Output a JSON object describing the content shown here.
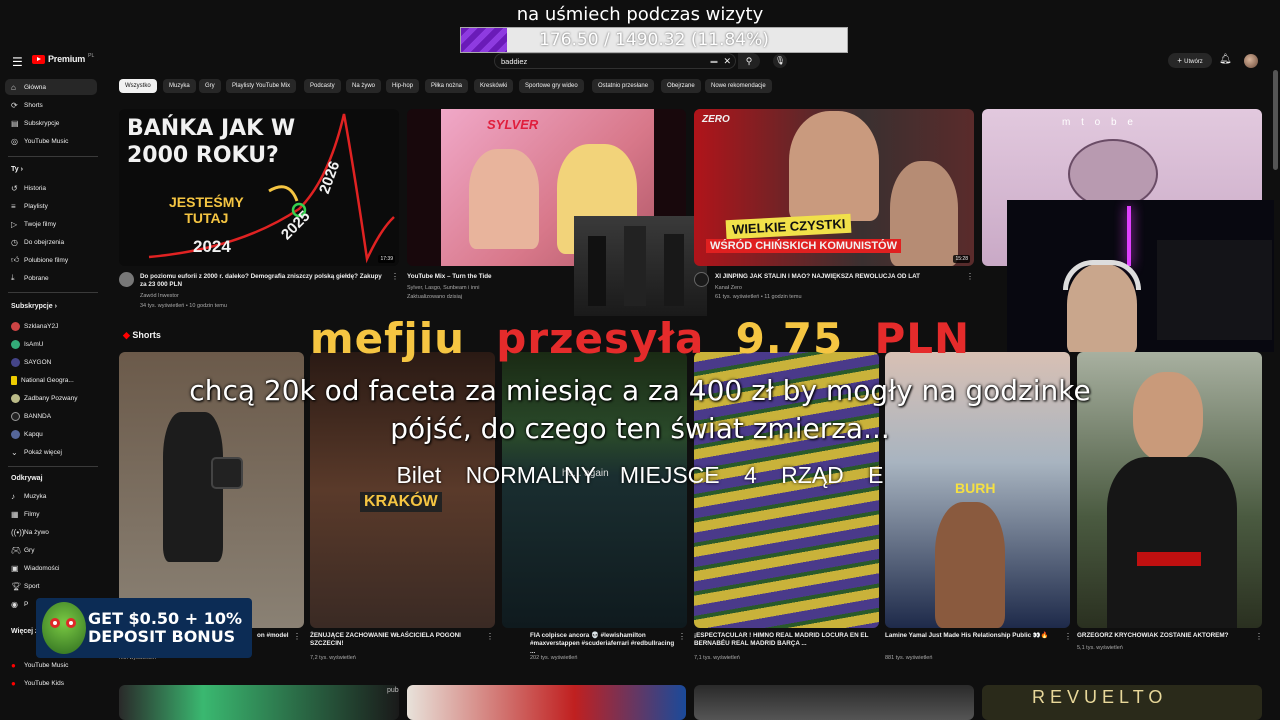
{
  "stream_overlay": {
    "goal_title": "na uśmiech podczas wizyty",
    "goal_progress_text": "176.50 / 1490.32 (11.84%)",
    "goal_fraction": 0.1184,
    "donation_name": "mefjiu",
    "donation_verb": "przesyła",
    "donation_amount": "9.75",
    "donation_currency": "PLN",
    "donation_message": "chcą 20k od faceta za miesiąc a za 400 zł by mogły na godzinke pójść, do czego ten świat zmierza...",
    "ticket_text": "Bilet NORMALNY MIEJSCE 4 RZĄD E",
    "bonus_line1": "GET $0.50 + 10%",
    "bonus_line2": "DEPOSIT BONUS"
  },
  "header": {
    "logo_text": "Premium",
    "logo_country": "PL",
    "search_value": "baddiez",
    "create_label": "Utwórz"
  },
  "sidebar": {
    "main": [
      "Główna",
      "Shorts",
      "Subskrypcje",
      "YouTube Music"
    ],
    "you_header": "Ty",
    "you": [
      "Historia",
      "Playlisty",
      "Twoje filmy",
      "Do obejrzenia",
      "Polubione filmy",
      "Pobrane"
    ],
    "subs_header": "Subskrypcje",
    "subs": [
      "SzklanaY2J",
      "IsAmU",
      "SAYGON",
      "National Geogra...",
      "Zadbany Pozwany",
      "BANNDA",
      "Kapqu",
      "Pokaż więcej"
    ],
    "explore_header": "Odkrywaj",
    "explore": [
      "Muzyka",
      "Filmy",
      "Na żywo",
      "Gry",
      "Wiadomości",
      "Sport",
      "P"
    ],
    "more_header": "Więcej z",
    "more": [
      "YouTube Music",
      "YouTube Kids"
    ]
  },
  "chips": [
    "Wszystko",
    "Muzyka",
    "Gry",
    "Playlisty YouTube Mix",
    "Podcasty",
    "Na żywo",
    "Hip-hop",
    "Piłka nożna",
    "Kreskówki",
    "Sportowe gry wideo",
    "Ostatnio przesłane",
    "Obejrzane",
    "Nowe rekomendacje"
  ],
  "videos": [
    {
      "title": "Do poziomu euforii z 2000 r. daleko? Demografia zniszczy polską giełdę? Zakupy za 23 000 PLN",
      "channel": "Zawód Inwestor",
      "meta": "34 tys. wyświetleń • 10 godzin temu",
      "duration": "17:39",
      "thumb_l1": "BAŃKA JAK W",
      "thumb_l2": "2000 ROKU?",
      "thumb_l3": "JESTEŚMY",
      "thumb_l4": "TUTAJ",
      "y2024": "2024",
      "y2025": "2025",
      "y2026": "2026"
    },
    {
      "title": "YouTube Mix – Turn the Tide",
      "channel": "Sylver, Lasgo, Sunbeam i inni",
      "meta": "Zaktualizowano dzisiaj",
      "thumb_brand": "SYLVER"
    },
    {
      "title": "XI JINPING JAK STALIN I MAO? NAJWIĘKSZA REWOLUCJA OD LAT",
      "channel": "Kanał Zero",
      "meta": "61 tys. wyświetleń • 11 godzin temu",
      "duration": "15:28",
      "thumb_l1": "WIELKIE CZYSTKI",
      "thumb_l2": "WŚRÓD CHIŃSKICH KOMUNISTÓW",
      "thumb_brand": "ZERO"
    },
    {
      "thumb_text": "m t o b e"
    }
  ],
  "shorts": {
    "header": "Shorts",
    "items": [
      {
        "title": "on #model",
        "meta": "mln wyświetleń"
      },
      {
        "title": "ŻENUJĄCE ZACHOWANIE WŁAŚCICIELA POGONI SZCZECIN!",
        "meta": "7,2 tys. wyświetleń",
        "thumb_text": "KRAKÓW"
      },
      {
        "title": "FIA colpisce ancora 💀 #lewishamilton #maxverstappen #scuderiaferrari #redbullracing ...",
        "meta": "202 tys. wyświetleń",
        "thumb_text": "he... again"
      },
      {
        "title": "¡ESPECTACULAR ! HIMNO REAL MADRID LOCURA EN EL BERNABÉU REAL MADRID BARÇA ...",
        "meta": "7,1 tys. wyświetleń"
      },
      {
        "title": "Lamine Yamal Just Made His Relationship Public 👀🔥",
        "meta": "881 tys. wyświetleń",
        "thumb_text": "BURH"
      },
      {
        "title": "GRZEGORZ KRYCHOWIAK ZOSTANIE AKTOREM?",
        "meta": "5,1 tys. wyświetleń"
      }
    ]
  },
  "bottom_row": {
    "pub_text": "pub",
    "rev_text": "REVUELTO"
  },
  "colors": {
    "bg": "#0f0f0f",
    "chip": "#272727",
    "accent": "#ff0000",
    "gold": "#f5c542",
    "red": "#e52b2b",
    "goal_fill": "#7a28c8"
  }
}
